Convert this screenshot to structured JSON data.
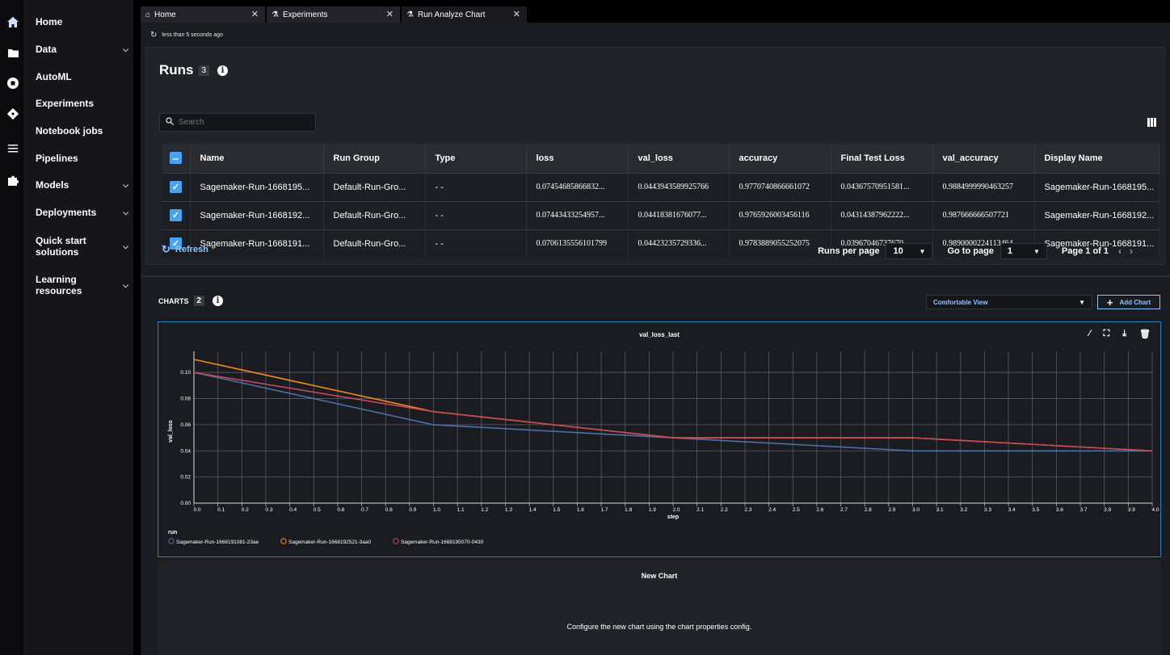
{
  "sidebar": {
    "items": [
      {
        "label": "Home",
        "chevron": false
      },
      {
        "label": "Data",
        "chevron": true
      },
      {
        "label": "AutoML",
        "chevron": false
      },
      {
        "label": "Experiments",
        "chevron": false
      },
      {
        "label": "Notebook jobs",
        "chevron": false
      },
      {
        "label": "Pipelines",
        "chevron": false
      },
      {
        "label": "Models",
        "chevron": true
      },
      {
        "label": "Deployments",
        "chevron": true
      },
      {
        "label": "Quick start solutions",
        "chevron": true
      },
      {
        "label": "Learning resources",
        "chevron": true
      }
    ]
  },
  "tabs": [
    {
      "label": "Home",
      "icon": "home-icon"
    },
    {
      "label": "Experiments",
      "icon": "flask-icon"
    },
    {
      "label": "Run Analyze Chart",
      "icon": "flask-icon"
    }
  ],
  "refreshed_text": "less than 5 seconds ago",
  "runs": {
    "title": "Runs",
    "count": "3",
    "search_placeholder": "Search",
    "columns": [
      "Name",
      "Run Group",
      "Type",
      "loss",
      "val_loss",
      "accuracy",
      "Final Test Loss",
      "val_accuracy",
      "Display Name"
    ],
    "rows": [
      [
        "Sagemaker-Run-1668195...",
        "Default-Run-Gro...",
        "- -",
        "0.07454685866832...",
        "0.0443943589925766",
        "0.9770740866661072",
        "0.04367570951581...",
        "0.9884999990463257",
        "Sagemaker-Run-1668195..."
      ],
      [
        "Sagemaker-Run-1668192...",
        "Default-Run-Gro...",
        "- -",
        "0.07443433254957...",
        "0.04418381676077...",
        "0.9765926003456116",
        "0.04314387962222...",
        "0.987666666507721",
        "Sagemaker-Run-1668192..."
      ],
      [
        "Sagemaker-Run-1668191...",
        "Default-Run-Gro...",
        "- -",
        "0.0706135556101799",
        "0.04423235729336...",
        "0.9783889055252075",
        "0.03967046737670...",
        "0.9890000224113464",
        "Sagemaker-Run-1668191..."
      ]
    ],
    "refresh_label": "Refresh",
    "runs_per_page_label": "Runs per page",
    "runs_per_page_value": "10",
    "go_to_page_label": "Go to page",
    "go_to_page_value": "1",
    "page_info": "Page 1 of 1"
  },
  "charts": {
    "title": "CHARTS",
    "count": "2",
    "view_select": "Comfortable View",
    "add_chart_label": "Add Chart",
    "new_chart_title": "New Chart",
    "new_chart_message": "Configure the new chart using the chart properties config."
  },
  "chart_data": {
    "type": "line",
    "title": "val_loss_last",
    "xlabel": "step",
    "ylabel": "val_loss",
    "xlim": [
      0,
      4
    ],
    "ylim": [
      0,
      0.11
    ],
    "xticks": [
      "0.0",
      "0.1",
      "0.2",
      "0.3",
      "0.4",
      "0.5",
      "0.6",
      "0.7",
      "0.8",
      "0.9",
      "1.0",
      "1.1",
      "1.2",
      "1.3",
      "1.4",
      "1.5",
      "1.6",
      "1.7",
      "1.8",
      "1.9",
      "2.0",
      "2.1",
      "2.2",
      "2.3",
      "2.4",
      "2.5",
      "2.6",
      "2.7",
      "2.8",
      "2.9",
      "3.0",
      "3.1",
      "3.2",
      "3.3",
      "3.4",
      "3.5",
      "3.6",
      "3.7",
      "3.8",
      "3.9",
      "4.0"
    ],
    "yticks": [
      "0.00",
      "0.02",
      "0.04",
      "0.06",
      "0.08",
      "0.10"
    ],
    "legend_title": "run",
    "legend_position": "bottom-left",
    "grid": true,
    "series": [
      {
        "name": "Sagemaker-Run-1668191081-23ae",
        "color": "#4f6fa8",
        "x": [
          0,
          1,
          2,
          3,
          4
        ],
        "y": [
          0.1,
          0.06,
          0.05,
          0.04,
          0.04
        ]
      },
      {
        "name": "Sagemaker-Run-1668192521-3aa0",
        "color": "#f08a1c",
        "x": [
          0,
          1,
          2,
          3,
          4
        ],
        "y": [
          0.11,
          0.07,
          0.05,
          0.05,
          0.04
        ]
      },
      {
        "name": "Sagemaker-Run-1668195070-0430",
        "color": "#c04a5a",
        "x": [
          0,
          1,
          2,
          3,
          4
        ],
        "y": [
          0.1,
          0.07,
          0.05,
          0.05,
          0.04
        ]
      }
    ]
  }
}
